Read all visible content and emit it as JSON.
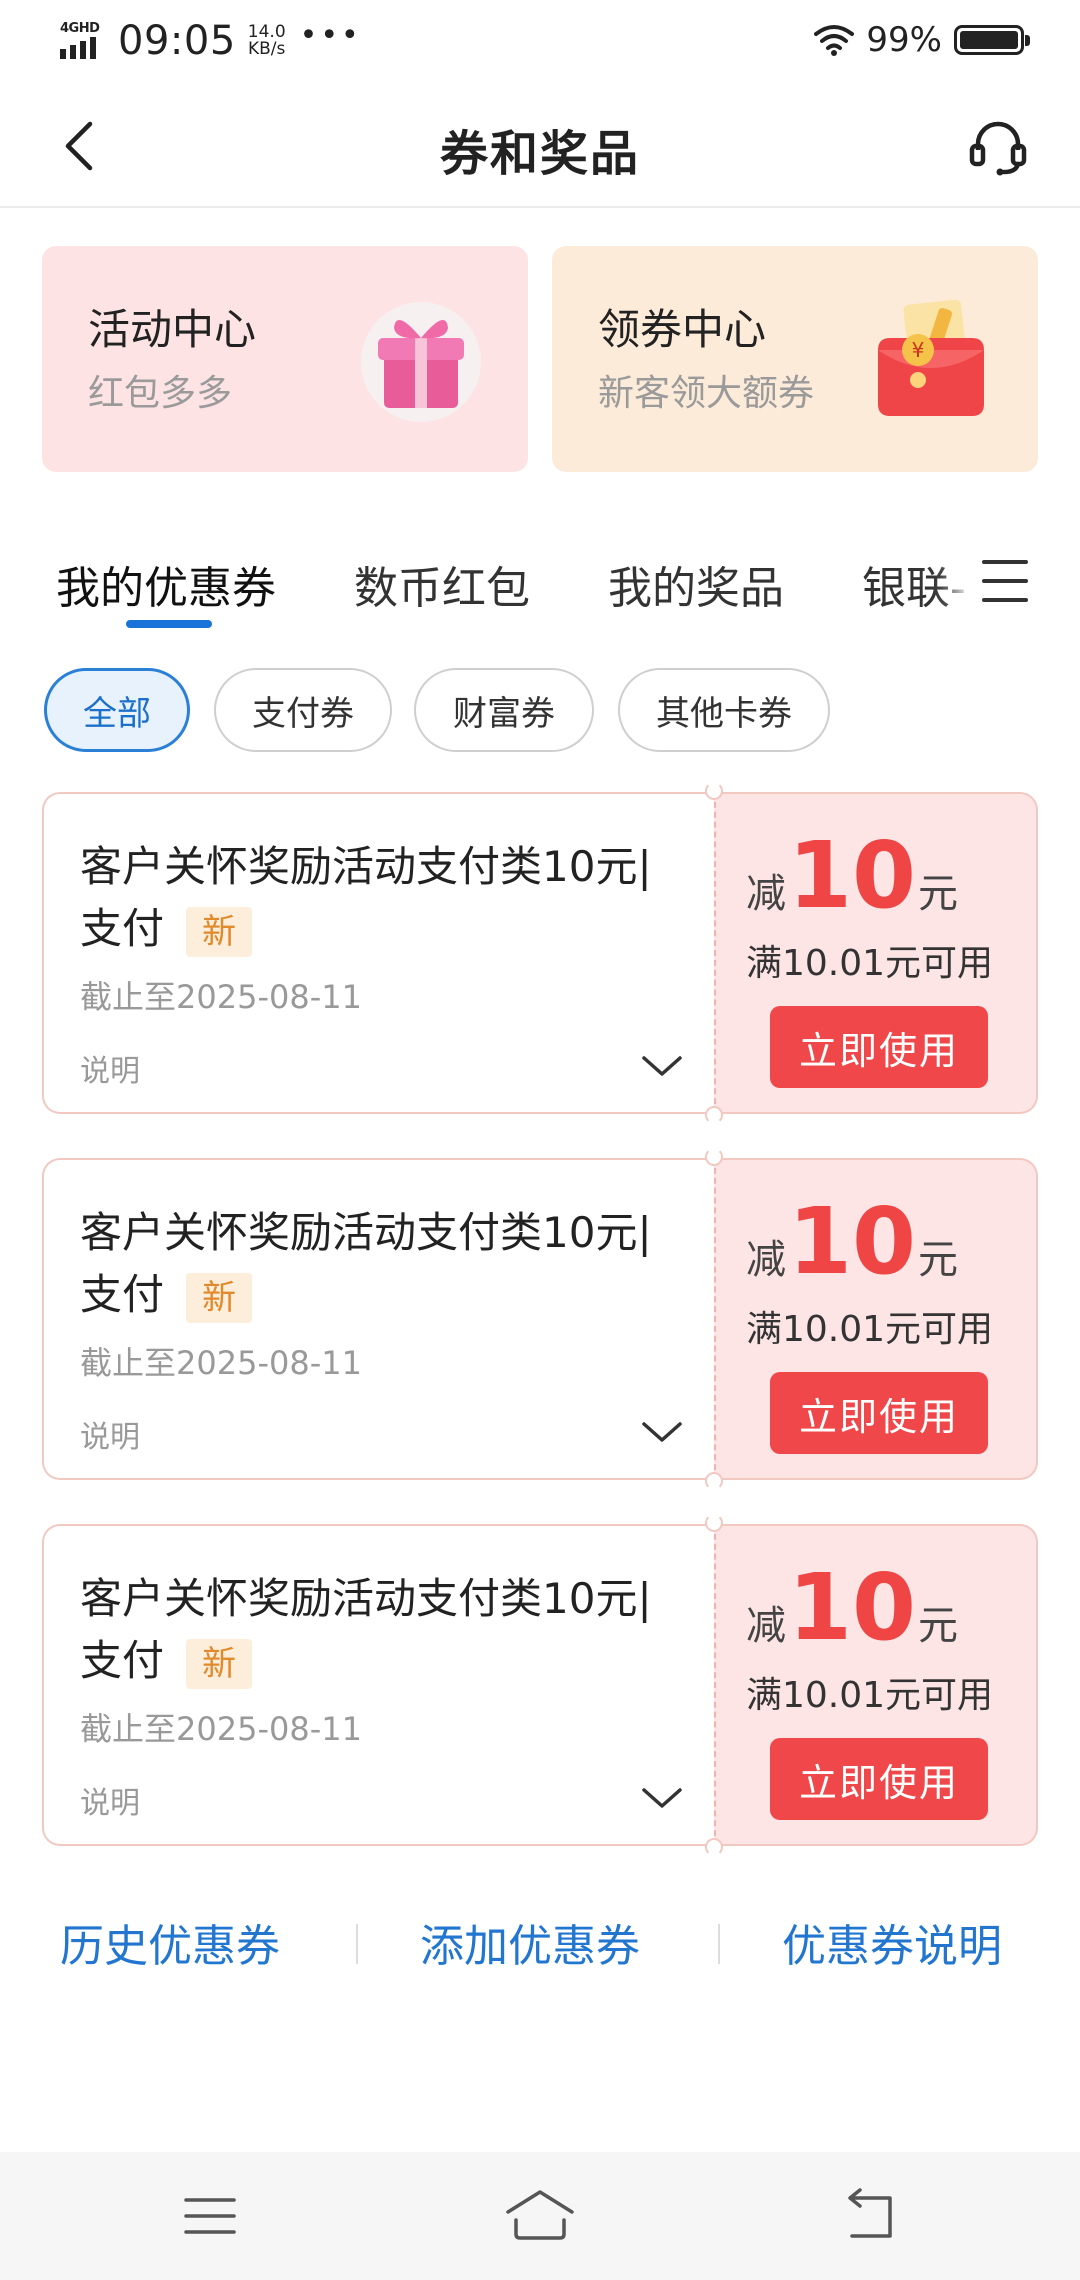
{
  "status_bar": {
    "network": "4GHD",
    "time": "09:05",
    "speed_value": "14.0",
    "speed_unit": "KB/s",
    "dots": "•••",
    "battery": "99%"
  },
  "nav": {
    "title": "券和奖品",
    "back_icon": "chevron-left-icon",
    "service_icon": "headset-icon"
  },
  "promos": [
    {
      "title": "活动中心",
      "subtitle": "红包多多",
      "icon": "gift-box-icon"
    },
    {
      "title": "领券中心",
      "subtitle": "新客领大额券",
      "icon": "red-envelope-coupon-icon"
    }
  ],
  "tabs": [
    {
      "label": "我的优惠券",
      "active": true
    },
    {
      "label": "数币红包"
    },
    {
      "label": "我的奖品"
    },
    {
      "label": "银联-"
    }
  ],
  "filters": [
    {
      "label": "全部",
      "active": true
    },
    {
      "label": "支付券"
    },
    {
      "label": "财富券"
    },
    {
      "label": "其他卡券"
    }
  ],
  "coupons": [
    {
      "title": "客户关怀奖励活动支付类10元|支付",
      "badge": "新",
      "expiry": "截止至2025-08-11",
      "description": "说明",
      "prefix": "减",
      "amount": "10",
      "unit": "元",
      "condition": "满10.01元可用",
      "button": "立即使用"
    },
    {
      "title": "客户关怀奖励活动支付类10元|支付",
      "badge": "新",
      "expiry": "截止至2025-08-11",
      "description": "说明",
      "prefix": "减",
      "amount": "10",
      "unit": "元",
      "condition": "满10.01元可用",
      "button": "立即使用"
    },
    {
      "title": "客户关怀奖励活动支付类10元|支付",
      "badge": "新",
      "expiry": "截止至2025-08-11",
      "description": "说明",
      "prefix": "减",
      "amount": "10",
      "unit": "元",
      "condition": "满10.01元可用",
      "button": "立即使用"
    }
  ],
  "footer": {
    "history": "历史优惠券",
    "add": "添加优惠券",
    "explain": "优惠券说明"
  },
  "colors": {
    "accent_blue": "#1a73d8",
    "coupon_red": "#f0484a",
    "coupon_bg": "#fde5e5",
    "badge_orange": "#e08a2c"
  }
}
